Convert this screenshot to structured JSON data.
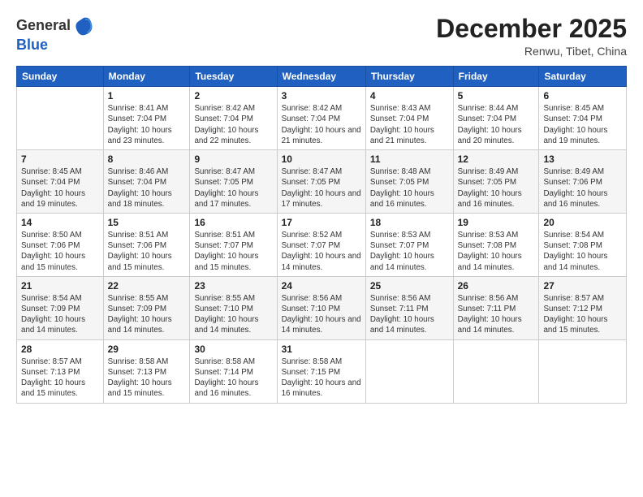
{
  "header": {
    "logo_general": "General",
    "logo_blue": "Blue",
    "month_title": "December 2025",
    "location": "Renwu, Tibet, China"
  },
  "days_of_week": [
    "Sunday",
    "Monday",
    "Tuesday",
    "Wednesday",
    "Thursday",
    "Friday",
    "Saturday"
  ],
  "weeks": [
    [
      {
        "day": "",
        "info": ""
      },
      {
        "day": "1",
        "info": "Sunrise: 8:41 AM\nSunset: 7:04 PM\nDaylight: 10 hours and 23 minutes."
      },
      {
        "day": "2",
        "info": "Sunrise: 8:42 AM\nSunset: 7:04 PM\nDaylight: 10 hours and 22 minutes."
      },
      {
        "day": "3",
        "info": "Sunrise: 8:42 AM\nSunset: 7:04 PM\nDaylight: 10 hours and 21 minutes."
      },
      {
        "day": "4",
        "info": "Sunrise: 8:43 AM\nSunset: 7:04 PM\nDaylight: 10 hours and 21 minutes."
      },
      {
        "day": "5",
        "info": "Sunrise: 8:44 AM\nSunset: 7:04 PM\nDaylight: 10 hours and 20 minutes."
      },
      {
        "day": "6",
        "info": "Sunrise: 8:45 AM\nSunset: 7:04 PM\nDaylight: 10 hours and 19 minutes."
      }
    ],
    [
      {
        "day": "7",
        "info": "Sunrise: 8:45 AM\nSunset: 7:04 PM\nDaylight: 10 hours and 19 minutes."
      },
      {
        "day": "8",
        "info": "Sunrise: 8:46 AM\nSunset: 7:04 PM\nDaylight: 10 hours and 18 minutes."
      },
      {
        "day": "9",
        "info": "Sunrise: 8:47 AM\nSunset: 7:05 PM\nDaylight: 10 hours and 17 minutes."
      },
      {
        "day": "10",
        "info": "Sunrise: 8:47 AM\nSunset: 7:05 PM\nDaylight: 10 hours and 17 minutes."
      },
      {
        "day": "11",
        "info": "Sunrise: 8:48 AM\nSunset: 7:05 PM\nDaylight: 10 hours and 16 minutes."
      },
      {
        "day": "12",
        "info": "Sunrise: 8:49 AM\nSunset: 7:05 PM\nDaylight: 10 hours and 16 minutes."
      },
      {
        "day": "13",
        "info": "Sunrise: 8:49 AM\nSunset: 7:06 PM\nDaylight: 10 hours and 16 minutes."
      }
    ],
    [
      {
        "day": "14",
        "info": "Sunrise: 8:50 AM\nSunset: 7:06 PM\nDaylight: 10 hours and 15 minutes."
      },
      {
        "day": "15",
        "info": "Sunrise: 8:51 AM\nSunset: 7:06 PM\nDaylight: 10 hours and 15 minutes."
      },
      {
        "day": "16",
        "info": "Sunrise: 8:51 AM\nSunset: 7:07 PM\nDaylight: 10 hours and 15 minutes."
      },
      {
        "day": "17",
        "info": "Sunrise: 8:52 AM\nSunset: 7:07 PM\nDaylight: 10 hours and 14 minutes."
      },
      {
        "day": "18",
        "info": "Sunrise: 8:53 AM\nSunset: 7:07 PM\nDaylight: 10 hours and 14 minutes."
      },
      {
        "day": "19",
        "info": "Sunrise: 8:53 AM\nSunset: 7:08 PM\nDaylight: 10 hours and 14 minutes."
      },
      {
        "day": "20",
        "info": "Sunrise: 8:54 AM\nSunset: 7:08 PM\nDaylight: 10 hours and 14 minutes."
      }
    ],
    [
      {
        "day": "21",
        "info": "Sunrise: 8:54 AM\nSunset: 7:09 PM\nDaylight: 10 hours and 14 minutes."
      },
      {
        "day": "22",
        "info": "Sunrise: 8:55 AM\nSunset: 7:09 PM\nDaylight: 10 hours and 14 minutes."
      },
      {
        "day": "23",
        "info": "Sunrise: 8:55 AM\nSunset: 7:10 PM\nDaylight: 10 hours and 14 minutes."
      },
      {
        "day": "24",
        "info": "Sunrise: 8:56 AM\nSunset: 7:10 PM\nDaylight: 10 hours and 14 minutes."
      },
      {
        "day": "25",
        "info": "Sunrise: 8:56 AM\nSunset: 7:11 PM\nDaylight: 10 hours and 14 minutes."
      },
      {
        "day": "26",
        "info": "Sunrise: 8:56 AM\nSunset: 7:11 PM\nDaylight: 10 hours and 14 minutes."
      },
      {
        "day": "27",
        "info": "Sunrise: 8:57 AM\nSunset: 7:12 PM\nDaylight: 10 hours and 15 minutes."
      }
    ],
    [
      {
        "day": "28",
        "info": "Sunrise: 8:57 AM\nSunset: 7:13 PM\nDaylight: 10 hours and 15 minutes."
      },
      {
        "day": "29",
        "info": "Sunrise: 8:58 AM\nSunset: 7:13 PM\nDaylight: 10 hours and 15 minutes."
      },
      {
        "day": "30",
        "info": "Sunrise: 8:58 AM\nSunset: 7:14 PM\nDaylight: 10 hours and 16 minutes."
      },
      {
        "day": "31",
        "info": "Sunrise: 8:58 AM\nSunset: 7:15 PM\nDaylight: 10 hours and 16 minutes."
      },
      {
        "day": "",
        "info": ""
      },
      {
        "day": "",
        "info": ""
      },
      {
        "day": "",
        "info": ""
      }
    ]
  ]
}
